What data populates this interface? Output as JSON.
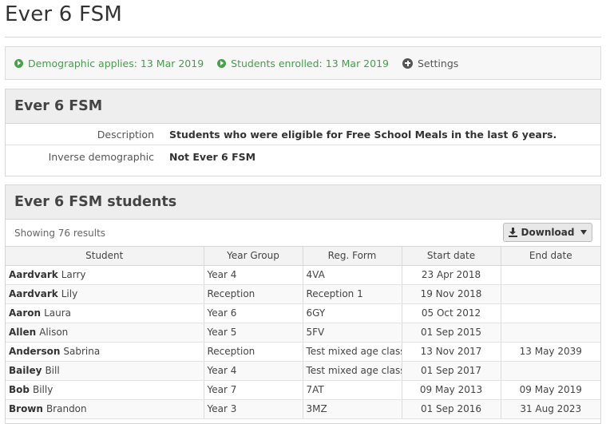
{
  "page": {
    "title": "Ever 6 FSM"
  },
  "status_bar": {
    "demographic": "Demographic applies: 13 Mar 2019",
    "enrolled": "Students enrolled: 13 Mar 2019",
    "settings": "Settings"
  },
  "demographic_panel": {
    "title": "Ever 6 FSM",
    "rows": [
      {
        "label": "Description",
        "value": "Students who were eligible for Free School Meals in the last 6 years."
      },
      {
        "label": "Inverse demographic",
        "value": "Not Ever 6 FSM"
      }
    ]
  },
  "students_panel": {
    "title": "Ever 6 FSM students",
    "result_count": "Showing 76 results",
    "download_label": "Download",
    "columns": [
      "Student",
      "Year Group",
      "Reg. Form",
      "Start date",
      "End date"
    ],
    "rows": [
      {
        "surname": "Aardvark",
        "forename": "Larry",
        "year": "Year 4",
        "form": "4VA",
        "start": "23 Apr 2018",
        "end": ""
      },
      {
        "surname": "Aardvark",
        "forename": "Lily",
        "year": "Reception",
        "form": "Reception 1",
        "start": "19 Nov 2018",
        "end": ""
      },
      {
        "surname": "Aaron",
        "forename": "Laura",
        "year": "Year 6",
        "form": "6GY",
        "start": "05 Oct 2012",
        "end": ""
      },
      {
        "surname": "Allen",
        "forename": "Alison",
        "year": "Year 5",
        "form": "5FV",
        "start": "01 Sep 2015",
        "end": ""
      },
      {
        "surname": "Anderson",
        "forename": "Sabrina",
        "year": "Reception",
        "form": "Test mixed age class",
        "start": "13 Nov 2017",
        "end": "13 May 2039"
      },
      {
        "surname": "Bailey",
        "forename": "Bill",
        "year": "Year 4",
        "form": "Test mixed age class",
        "start": "01 Sep 2017",
        "end": ""
      },
      {
        "surname": "Bob",
        "forename": "Billy",
        "year": "Year 7",
        "form": "7AT",
        "start": "09 May 2013",
        "end": "09 May 2019"
      },
      {
        "surname": "Brown",
        "forename": "Brandon",
        "year": "Year 3",
        "form": "3MZ",
        "start": "01 Sep 2016",
        "end": "31 Aug 2023"
      }
    ]
  }
}
